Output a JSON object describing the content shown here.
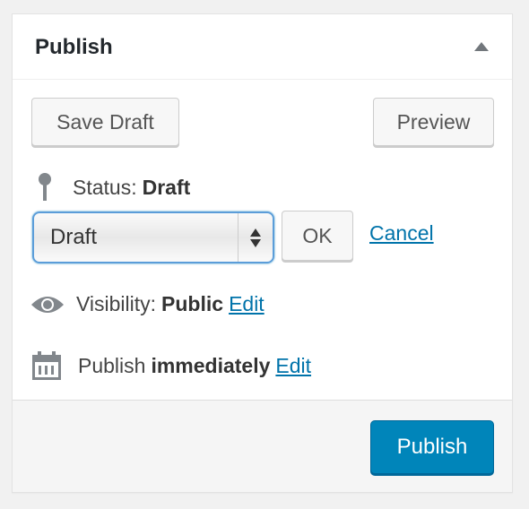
{
  "header": {
    "title": "Publish",
    "toggle_icon": "triangle-up-icon"
  },
  "actions": {
    "save_draft": "Save Draft",
    "preview": "Preview"
  },
  "status": {
    "label": "Status:",
    "value": "Draft",
    "icon": "pin-icon",
    "select_value": "Draft",
    "ok": "OK",
    "cancel": "Cancel"
  },
  "visibility": {
    "label": "Visibility:",
    "value": "Public",
    "edit": "Edit",
    "icon": "eye-icon"
  },
  "schedule": {
    "label": "Publish",
    "value": "immediately",
    "edit": "Edit",
    "icon": "calendar-icon"
  },
  "footer": {
    "publish": "Publish"
  },
  "colors": {
    "primary": "#0085ba",
    "link": "#0073aa"
  }
}
